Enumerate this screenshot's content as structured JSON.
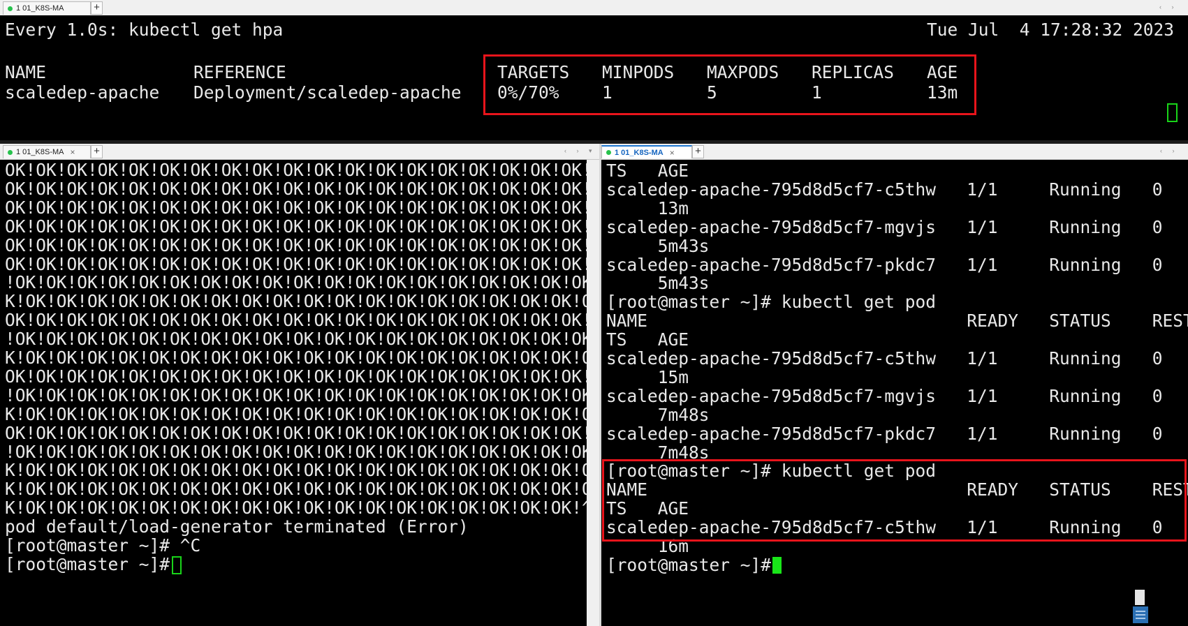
{
  "top_pane": {
    "tab_label": "1 01_K8S-MA",
    "watch_header": "Every 1.0s: kubectl get hpa",
    "timestamp": "Tue Jul  4 17:28:32 2023",
    "columns": [
      "NAME",
      "REFERENCE",
      "TARGETS",
      "MINPODS",
      "MAXPODS",
      "REPLICAS",
      "AGE"
    ],
    "row": [
      "scaledep-apache",
      "Deployment/scaledep-apache",
      "0%/70%",
      "1",
      "5",
      "1",
      "13m"
    ]
  },
  "left_pane": {
    "tab_label": "1 01_K8S-MA",
    "lines": [
      "OK!OK!OK!OK!OK!OK!OK!OK!OK!OK!OK!OK!OK!OK!OK!OK!OK!OK!OK!OK",
      "OK!OK!OK!OK!OK!OK!OK!OK!OK!OK!OK!OK!OK!OK!OK!OK!OK!OK!OK!OK",
      "OK!OK!OK!OK!OK!OK!OK!OK!OK!OK!OK!OK!OK!OK!OK!OK!OK!OK!OK!OK",
      "OK!OK!OK!OK!OK!OK!OK!OK!OK!OK!OK!OK!OK!OK!OK!OK!OK!OK!OK!OK",
      "OK!OK!OK!OK!OK!OK!OK!OK!OK!OK!OK!OK!OK!OK!OK!OK!OK!OK!OK!OK",
      "OK!OK!OK!OK!OK!OK!OK!OK!OK!OK!OK!OK!OK!OK!OK!OK!OK!OK!OK!OK",
      "!OK!OK!OK!OK!OK!OK!OK!OK!OK!OK!OK!OK!OK!OK!OK!OK!OK!OK!OK!O",
      "K!OK!OK!OK!OK!OK!OK!OK!OK!OK!OK!OK!OK!OK!OK!OK!OK!OK!OK!OK!",
      "OK!OK!OK!OK!OK!OK!OK!OK!OK!OK!OK!OK!OK!OK!OK!OK!OK!OK!OK!OK",
      "!OK!OK!OK!OK!OK!OK!OK!OK!OK!OK!OK!OK!OK!OK!OK!OK!OK!OK!OK!O",
      "K!OK!OK!OK!OK!OK!OK!OK!OK!OK!OK!OK!OK!OK!OK!OK!OK!OK!OK!OK!",
      "OK!OK!OK!OK!OK!OK!OK!OK!OK!OK!OK!OK!OK!OK!OK!OK!OK!OK!OK!OK",
      "!OK!OK!OK!OK!OK!OK!OK!OK!OK!OK!OK!OK!OK!OK!OK!OK!OK!OK!OK!O",
      "K!OK!OK!OK!OK!OK!OK!OK!OK!OK!OK!OK!OK!OK!OK!OK!OK!OK!OK!OK!",
      "OK!OK!OK!OK!OK!OK!OK!OK!OK!OK!OK!OK!OK!OK!OK!OK!OK!OK!OK!OK",
      "!OK!OK!OK!OK!OK!OK!OK!OK!OK!OK!OK!OK!OK!OK!OK!OK!OK!OK!OK!O",
      "K!OK!OK!OK!OK!OK!OK!OK!OK!OK!OK!OK!OK!OK!OK!OK!OK!OK!OK!OK!",
      "K!OK!OK!OK!OK!OK!OK!OK!OK!OK!OK!OK!OK!OK!OK!OK!OK!OK!OK!OK!",
      "K!OK!OK!OK!OK!OK!OK!OK!OK!OK!OK!OK!OK!OK!OK!OK!OK!OK!OK!^Cp",
      "pod default/load-generator terminated (Error)",
      "[root@master ~]# ^C",
      "[root@master ~]# "
    ]
  },
  "right_pane": {
    "tab_label": "1 01_K8S-MA",
    "lines": [
      "TS   AGE",
      "scaledep-apache-795d8d5cf7-c5thw   1/1     Running   0",
      "     13m",
      "scaledep-apache-795d8d5cf7-mgvjs   1/1     Running   0",
      "     5m43s",
      "scaledep-apache-795d8d5cf7-pkdc7   1/1     Running   0",
      "     5m43s",
      "[root@master ~]# kubectl get pod",
      "NAME                               READY   STATUS    RESTAR",
      "TS   AGE",
      "scaledep-apache-795d8d5cf7-c5thw   1/1     Running   0",
      "     15m",
      "scaledep-apache-795d8d5cf7-mgvjs   1/1     Running   0",
      "     7m48s",
      "scaledep-apache-795d8d5cf7-pkdc7   1/1     Running   0",
      "     7m48s",
      "[root@master ~]# kubectl get pod",
      "NAME                               READY   STATUS    RESTAR",
      "TS   AGE",
      "scaledep-apache-795d8d5cf7-c5thw   1/1     Running   0",
      "     16m",
      "[root@master ~]# "
    ]
  },
  "colors": {
    "terminal_bg": "#000000",
    "terminal_fg": "#e8e8e8",
    "highlight_border": "#e8141b",
    "cursor": "#19e619",
    "active_tab_accent": "#1e78d2"
  },
  "icons": [
    "tab-status-dot-icon",
    "new-tab-plus-icon",
    "close-tab-icon",
    "scroll-left-icon",
    "scroll-right-icon",
    "tab-list-dropdown-icon",
    "notes-icon"
  ]
}
